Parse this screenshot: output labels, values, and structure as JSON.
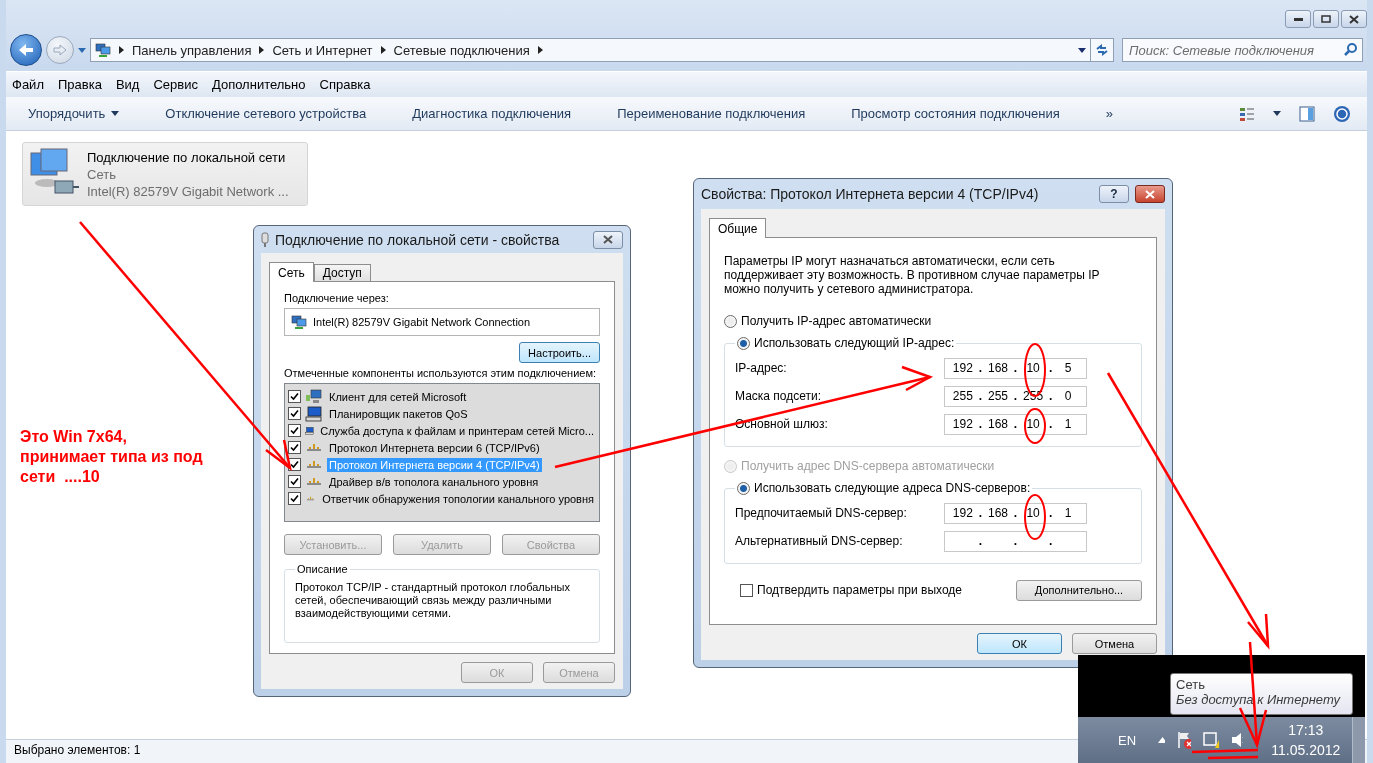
{
  "window": {
    "address_path": [
      "Панель управления",
      "Сеть и Интернет",
      "Сетевые подключения"
    ],
    "search": {
      "placeholder": "Поиск: Сетевые подключения"
    }
  },
  "menu": [
    "Файл",
    "Правка",
    "Вид",
    "Сервис",
    "Дополнительно",
    "Справка"
  ],
  "toolbar": [
    {
      "label": "Упорядочить",
      "kind": "menu"
    },
    {
      "label": "Отключение сетевого устройства",
      "kind": "action"
    },
    {
      "label": "Диагностика подключения",
      "kind": "action"
    },
    {
      "label": "Переименование подключения",
      "kind": "action"
    },
    {
      "label": "Просмотр состояния подключения",
      "kind": "action"
    },
    {
      "label": "»",
      "kind": "overflow"
    }
  ],
  "connection": {
    "name": "Подключение по локальной сети",
    "network": "Сеть",
    "adapter": "Intel(R) 82579V Gigabit Network ...",
    "selected": true
  },
  "status_bar": "Выбрано элементов: 1",
  "note": "Это Win 7x64, принимает типа из под сети  ....10",
  "lan_dialog": {
    "title": "Подключение по локальной сети - свойства",
    "tabs": [
      {
        "label": "Сеть",
        "selected": true
      },
      {
        "label": "Доступ",
        "selected": false
      }
    ],
    "connect_label": "Подключение через:",
    "adapter": "Intel(R) 82579V Gigabit Network Connection",
    "configure_button": {
      "label": "Настроить...",
      "default": true
    },
    "components_label": "Отмеченные компоненты используются этим подключением:",
    "components": [
      {
        "label": "Клиент для сетей Microsoft",
        "kind": "client",
        "checked": true,
        "selected": false
      },
      {
        "label": "Планировщик пакетов QoS",
        "kind": "service",
        "checked": true,
        "selected": false
      },
      {
        "label": "Служба доступа к файлам и принтерам сетей Micro...",
        "kind": "service",
        "checked": true,
        "selected": false
      },
      {
        "label": "Протокол Интернета версии 6 (TCP/IPv6)",
        "kind": "protocol",
        "checked": true,
        "selected": false
      },
      {
        "label": "Протокол Интернета версии 4 (TCP/IPv4)",
        "kind": "protocol",
        "checked": true,
        "selected": true
      },
      {
        "label": "Драйвер в/в тополога канального уровня",
        "kind": "protocol",
        "checked": true,
        "selected": false
      },
      {
        "label": "Ответчик обнаружения топологии канального уровня",
        "kind": "protocol",
        "checked": true,
        "selected": false
      }
    ],
    "buttons": [
      {
        "label": "Установить...",
        "disabled": true
      },
      {
        "label": "Удалить",
        "disabled": true
      },
      {
        "label": "Свойства",
        "disabled": true
      }
    ],
    "description_title": "Описание",
    "description": "Протокол TCP/IP - стандартный протокол глобальных сетей, обеспечивающий связь между различными взаимодействующими сетями.",
    "footer_buttons": [
      {
        "label": "ОК",
        "disabled": true
      },
      {
        "label": "Отмена",
        "disabled": true
      }
    ]
  },
  "ipv4_dialog": {
    "title": "Свойства: Протокол Интернета версии 4 (TCP/IPv4)",
    "help": "?",
    "tabs": [
      {
        "label": "Общие",
        "selected": true
      }
    ],
    "intro": "Параметры IP могут назначаться автоматически, если сеть поддерживает эту возможность. В противном случае параметры IP можно получить у сетевого администратора.",
    "separator": ".",
    "ip_mode": [
      {
        "label": "Получить IP-адрес автоматически",
        "selected": false,
        "disabled": false
      },
      {
        "label": "Использовать следующий IP-адрес:",
        "selected": true,
        "disabled": false
      }
    ],
    "ip_fields": [
      {
        "label": "IP-адрес:",
        "octets": [
          "192",
          "168",
          "10",
          "5"
        ]
      },
      {
        "label": "Маска подсети:",
        "octets": [
          "255",
          "255",
          "255",
          "0"
        ]
      },
      {
        "label": "Основной шлюз:",
        "octets": [
          "192",
          "168",
          "10",
          "1"
        ]
      }
    ],
    "dns_mode": [
      {
        "label": "Получить адрес DNS-сервера автоматически",
        "selected": false,
        "disabled": true
      },
      {
        "label": "Использовать следующие адреса DNS-серверов:",
        "selected": true,
        "disabled": false
      }
    ],
    "dns_fields": [
      {
        "label": "Предпочитаемый DNS-сервер:",
        "octets": [
          "192",
          "168",
          "10",
          "1"
        ]
      },
      {
        "label": "Альтернативный DNS-сервер:"
      }
    ],
    "confirm": {
      "label": "Подтвердить параметры при выходе",
      "checked": false
    },
    "advanced_button": "Дополнительно...",
    "buttons": [
      {
        "label": "ОК",
        "default": true
      },
      {
        "label": "Отмена",
        "default": false
      }
    ]
  },
  "tray": {
    "tooltip": {
      "title": "Сеть",
      "text": "Без доступа к Интернету"
    },
    "language": "EN",
    "time": "17:13",
    "date": "11.05.2012"
  }
}
